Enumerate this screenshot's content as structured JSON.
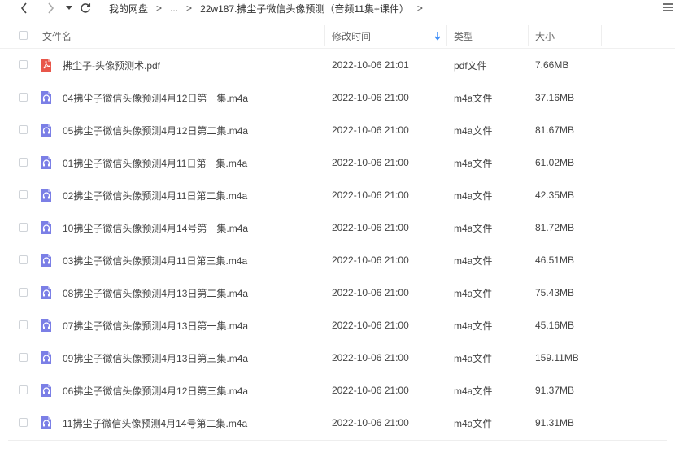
{
  "toolbar": {
    "breadcrumb": [
      "我的网盘",
      "...",
      "22w187.拂尘子微信头像预测（音频11集+课件）"
    ],
    "separator": ">"
  },
  "header": {
    "name": "文件名",
    "modified": "修改时间",
    "type": "类型",
    "size": "大小"
  },
  "colors": {
    "pdf": "#e8564a",
    "audio": "#7b7fe6",
    "sort_arrow": "#3b8cf7"
  },
  "files": [
    {
      "name": "拂尘子-头像预测术.pdf",
      "modified": "2022-10-06 21:01",
      "type": "pdf文件",
      "size": "7.66MB",
      "icon": "pdf-icon"
    },
    {
      "name": "04拂尘子微信头像预测4月12日第一集.m4a",
      "modified": "2022-10-06 21:00",
      "type": "m4a文件",
      "size": "37.16MB",
      "icon": "audio-icon"
    },
    {
      "name": "05拂尘子微信头像预测4月12日第二集.m4a",
      "modified": "2022-10-06 21:00",
      "type": "m4a文件",
      "size": "81.67MB",
      "icon": "audio-icon"
    },
    {
      "name": "01拂尘子微信头像预测4月11日第一集.m4a",
      "modified": "2022-10-06 21:00",
      "type": "m4a文件",
      "size": "61.02MB",
      "icon": "audio-icon"
    },
    {
      "name": "02拂尘子微信头像预测4月11日第二集.m4a",
      "modified": "2022-10-06 21:00",
      "type": "m4a文件",
      "size": "42.35MB",
      "icon": "audio-icon"
    },
    {
      "name": "10拂尘子微信头像预测4月14号第一集.m4a",
      "modified": "2022-10-06 21:00",
      "type": "m4a文件",
      "size": "81.72MB",
      "icon": "audio-icon"
    },
    {
      "name": "03拂尘子微信头像预测4月11日第三集.m4a",
      "modified": "2022-10-06 21:00",
      "type": "m4a文件",
      "size": "46.51MB",
      "icon": "audio-icon"
    },
    {
      "name": "08拂尘子微信头像预测4月13日第二集.m4a",
      "modified": "2022-10-06 21:00",
      "type": "m4a文件",
      "size": "75.43MB",
      "icon": "audio-icon"
    },
    {
      "name": "07拂尘子微信头像预测4月13日第一集.m4a",
      "modified": "2022-10-06 21:00",
      "type": "m4a文件",
      "size": "45.16MB",
      "icon": "audio-icon"
    },
    {
      "name": "09拂尘子微信头像预测4月13日第三集.m4a",
      "modified": "2022-10-06 21:00",
      "type": "m4a文件",
      "size": "159.11MB",
      "icon": "audio-icon"
    },
    {
      "name": "06拂尘子微信头像预测4月12日第三集.m4a",
      "modified": "2022-10-06 21:00",
      "type": "m4a文件",
      "size": "91.37MB",
      "icon": "audio-icon"
    },
    {
      "name": "11拂尘子微信头像预测4月14号第二集.m4a",
      "modified": "2022-10-06 21:00",
      "type": "m4a文件",
      "size": "91.31MB",
      "icon": "audio-icon"
    }
  ]
}
